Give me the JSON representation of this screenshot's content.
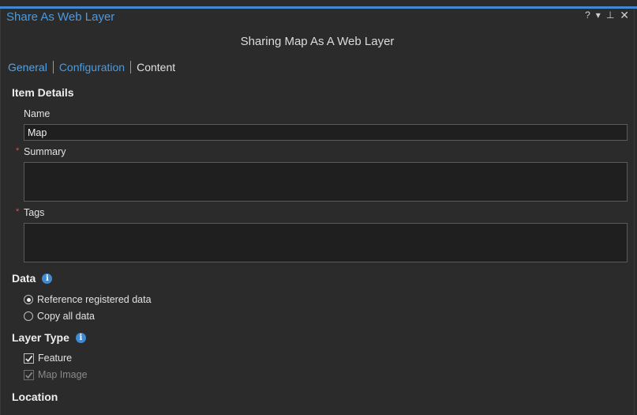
{
  "window": {
    "title": "Share As Web Layer",
    "controls": {
      "help": "?",
      "menu": "▾",
      "pin": "⊥",
      "close": "✕"
    }
  },
  "subtitle": "Sharing Map As A Web Layer",
  "tabs": [
    {
      "label": "General",
      "active": true
    },
    {
      "label": "Configuration",
      "active": false
    },
    {
      "label": "Content",
      "active": false
    }
  ],
  "item_details": {
    "heading": "Item Details",
    "name_label": "Name",
    "name_value": "Map",
    "required_marker": "*",
    "summary_label": "Summary",
    "summary_value": "",
    "tags_label": "Tags",
    "tags_value": ""
  },
  "data_section": {
    "heading": "Data",
    "info_icon": "info-icon",
    "options": [
      {
        "label": "Reference registered data",
        "selected": true
      },
      {
        "label": "Copy all data",
        "selected": false
      }
    ]
  },
  "layer_type": {
    "heading": "Layer Type",
    "info_icon": "info-icon",
    "options": [
      {
        "label": "Feature",
        "checked": true,
        "enabled": true
      },
      {
        "label": "Map Image",
        "checked": true,
        "enabled": false
      }
    ]
  },
  "location": {
    "heading": "Location"
  },
  "colors": {
    "accent": "#3f8ad1",
    "required": "#d9534f",
    "background": "#2b2b2b"
  }
}
